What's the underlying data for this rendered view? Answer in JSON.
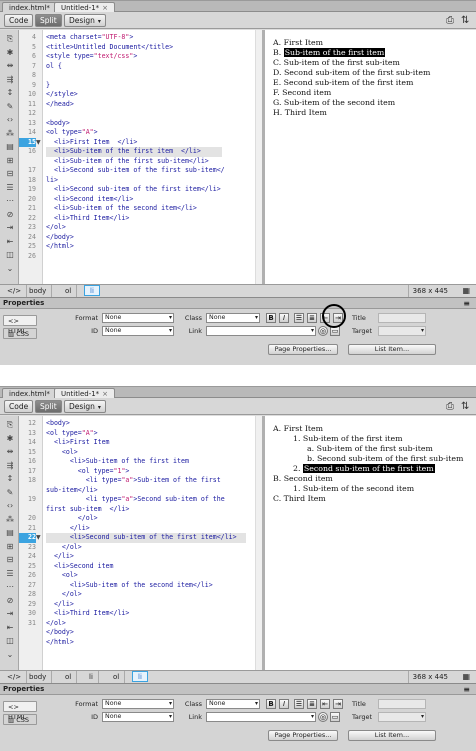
{
  "tabs": [
    "index.html*",
    "Untitled-1*"
  ],
  "tab_close": "×",
  "toolbar": {
    "code": "Code",
    "split": "Split",
    "design": "Design",
    "arrow": "▾"
  },
  "toolbar_icons": {
    "left": "⎙",
    "right": "⇅"
  },
  "status": {
    "code_tag": "</>",
    "size": "368 x 445",
    "arrow": "▸"
  },
  "props": {
    "title": "Properties",
    "html": "HTML",
    "css": "CSS",
    "format": "Format",
    "format_value": "None",
    "class": "Class",
    "class_value": "None",
    "id": "ID",
    "id_value": "None",
    "link": "Link",
    "title_label": "Title",
    "target": "Target",
    "page_properties": "Page Properties...",
    "list_item": "List Item...",
    "bold": "B",
    "italic": "I",
    "dd": "▾"
  },
  "panel1": {
    "line_numbers": [
      "4",
      "5",
      "6",
      "7",
      "8",
      "9",
      "10",
      "11",
      "12",
      "13",
      "14",
      "15",
      "16",
      "",
      "17",
      "18",
      "19",
      "20",
      "21",
      "22",
      "23",
      "24",
      "25",
      "26"
    ],
    "current_line": "15",
    "code": [
      [
        "<meta charset=",
        "\"UTF-8\"",
        ">"
      ],
      [
        "<title>Untitled Document</title>"
      ],
      [
        "<style type=",
        "\"text/css\"",
        ">"
      ],
      [
        "ol {"
      ],
      [
        ""
      ],
      [
        "}"
      ],
      [
        "</style>"
      ],
      [
        "</head>"
      ],
      [
        ""
      ],
      [
        "<body>"
      ],
      [
        "<ol type=",
        "\"A\"",
        ">"
      ],
      [
        "  <li>First Item  </li>"
      ],
      [
        "  <li>Sub-item of the first item  </li>"
      ],
      [
        "  <li>Sub-item of the first sub-item</li>"
      ],
      [
        "  <li>Second sub-item of the first sub-item</"
      ],
      [
        "li>"
      ],
      [
        "  <li>Second sub-item of the first item</li>"
      ],
      [
        "  <li>Second item</li>"
      ],
      [
        "  <li>Sub-item of the second item</li>"
      ],
      [
        "  <li>Third Item</li>"
      ],
      [
        "</ol>"
      ],
      [
        "</body>"
      ],
      [
        "</html>"
      ]
    ],
    "design": [
      {
        "marker": "A.",
        "text": "First Item"
      },
      {
        "marker": "B.",
        "text": "Sub-item of the first item",
        "selected": true
      },
      {
        "marker": "C.",
        "text": "Sub-item of the first sub-item"
      },
      {
        "marker": "D.",
        "text": "Second sub-item of the first sub-item"
      },
      {
        "marker": "E.",
        "text": "Second sub-item of the first item"
      },
      {
        "marker": "F.",
        "text": "Second item"
      },
      {
        "marker": "G.",
        "text": "Sub-item of the second item"
      },
      {
        "marker": "H.",
        "text": "Third Item"
      }
    ],
    "breadcrumbs": [
      "body",
      "ol",
      "li"
    ]
  },
  "panel2": {
    "line_numbers": [
      "12",
      "13",
      "14",
      "15",
      "16",
      "17",
      "18",
      "",
      "19",
      "",
      "20",
      "21",
      "22",
      "23",
      "24",
      "25",
      "26",
      "27",
      "28",
      "29",
      "30",
      "31"
    ],
    "current_line": "22",
    "code": [
      [
        "<body>"
      ],
      [
        "<ol type=",
        "\"A\"",
        ">"
      ],
      [
        "  <li>First Item"
      ],
      [
        "    <ol>"
      ],
      [
        "      <li>Sub-item of the first item"
      ],
      [
        "        <ol type=",
        "\"1\"",
        ">"
      ],
      [
        "          <li type=",
        "\"a\"",
        ">Sub-item of the first"
      ],
      [
        "sub-item</li>"
      ],
      [
        "          <li type=",
        "\"a\"",
        ">Second sub-item of the"
      ],
      [
        "first sub-item  </li>"
      ],
      [
        "        </ol>"
      ],
      [
        "      </li>"
      ],
      [
        "      <li>Second sub-item of the first item</li>"
      ],
      [
        "    </ol>"
      ],
      [
        "  </li>"
      ],
      [
        "  <li>Second item"
      ],
      [
        "    <ol>"
      ],
      [
        "      <li>Sub-item of the second item</li>"
      ],
      [
        "    </ol>"
      ],
      [
        "  </li>"
      ],
      [
        "  <li>Third Item</li>"
      ],
      [
        "</ol>"
      ],
      [
        "</body>"
      ],
      [
        "</html>"
      ]
    ],
    "design": [
      {
        "marker": "A.",
        "text": "First Item",
        "indent": 0
      },
      {
        "marker": "1.",
        "text": "Sub-item of the first item",
        "indent": 1
      },
      {
        "marker": "a.",
        "text": "Sub-item of the first sub-item",
        "indent": 2
      },
      {
        "marker": "b.",
        "text": "Second sub-item of the first sub-item",
        "indent": 2
      },
      {
        "marker": "2.",
        "text": "Second sub-item of the first item",
        "indent": 1,
        "selected": true
      },
      {
        "marker": "B.",
        "text": "Second item",
        "indent": 0
      },
      {
        "marker": "1.",
        "text": "Sub-item of the second item",
        "indent": 1
      },
      {
        "marker": "C.",
        "text": "Third Item",
        "indent": 0
      }
    ],
    "breadcrumbs": [
      "body",
      "ol",
      "li",
      "ol",
      "li"
    ]
  }
}
